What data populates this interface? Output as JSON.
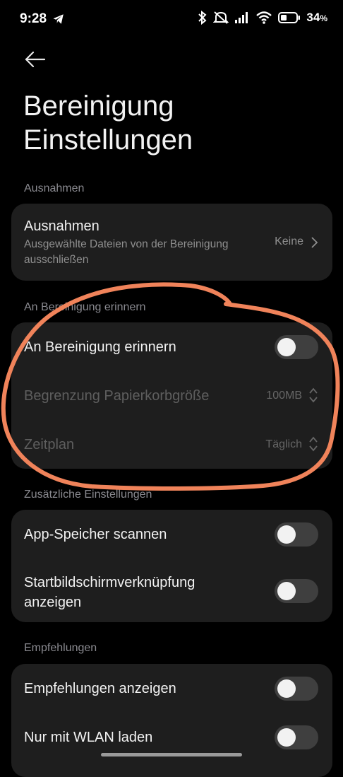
{
  "status_bar": {
    "time": "9:28",
    "battery": "34",
    "battery_unit": "%"
  },
  "page": {
    "title": "Bereinigung Einstellungen"
  },
  "sections": {
    "exceptions": {
      "label": "Ausnahmen",
      "row": {
        "title": "Ausnahmen",
        "subtitle": "Ausgewählte Dateien von der Bereinigung ausschließen",
        "value": "Keine"
      }
    },
    "reminder": {
      "label": "An Bereinigung erinnern",
      "toggle_row": {
        "title": "An Bereinigung erinnern",
        "enabled": false
      },
      "size_row": {
        "title": "Begrenzung Papierkorbgröße",
        "value": "100MB"
      },
      "schedule_row": {
        "title": "Zeitplan",
        "value": "Täglich"
      }
    },
    "additional": {
      "label": "Zusätzliche Einstellungen",
      "app_scan": {
        "title": "App-Speicher scannen",
        "enabled": false
      },
      "shortcut": {
        "title": "Startbildschirmverknüpfung anzeigen",
        "enabled": false
      }
    },
    "recommendations": {
      "label": "Empfehlungen",
      "show": {
        "title": "Empfehlungen anzeigen",
        "enabled": false
      },
      "wlan": {
        "title": "Nur mit WLAN laden",
        "enabled": false
      }
    }
  },
  "colors": {
    "annotation": "#f0835a",
    "card": "#1e1e1e",
    "background": "#000000"
  }
}
